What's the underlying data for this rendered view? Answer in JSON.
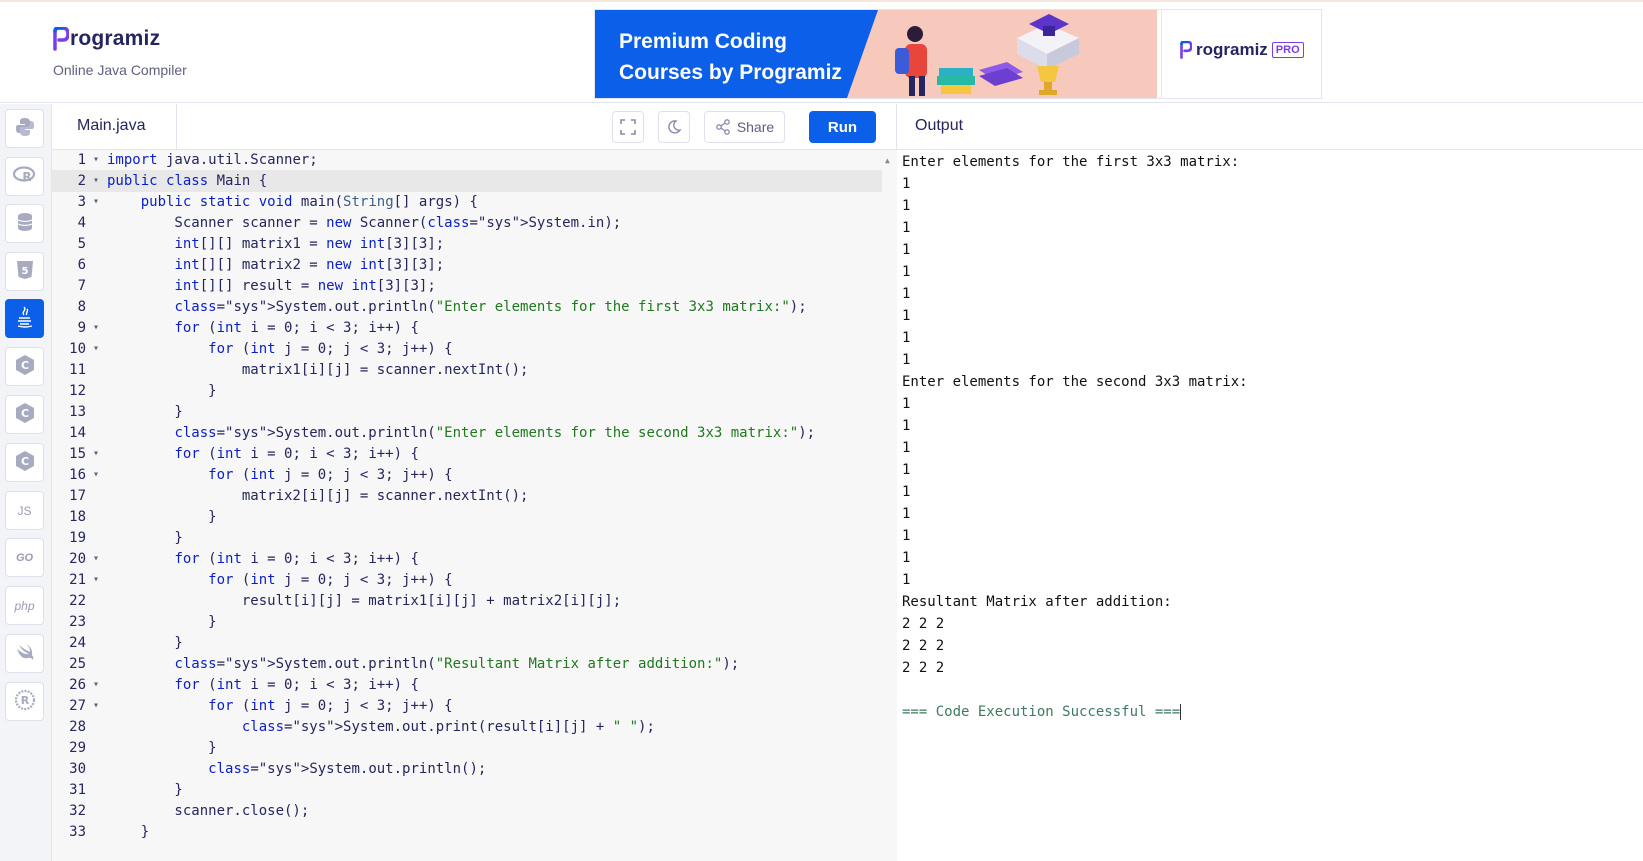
{
  "app": {
    "logo_text": "rogramiz",
    "subtitle": "Online Java Compiler"
  },
  "banner": {
    "title_line1": "Premium Coding",
    "title_line2": "Courses by Programiz",
    "pro_logo_text": "rogramiz",
    "pro_badge": "PRO"
  },
  "sidebar": {
    "items": [
      {
        "icon": "python-icon",
        "glyph": "",
        "active": false
      },
      {
        "icon": "r-lang-icon",
        "glyph": "R",
        "active": false
      },
      {
        "icon": "sql-database-icon",
        "glyph": "",
        "active": false
      },
      {
        "icon": "html5-icon",
        "glyph": "5",
        "active": false
      },
      {
        "icon": "java-icon",
        "glyph": "☕",
        "active": true
      },
      {
        "icon": "c-lang-icon",
        "glyph": "C",
        "active": false
      },
      {
        "icon": "cpp-icon",
        "glyph": "C",
        "active": false
      },
      {
        "icon": "csharp-icon",
        "glyph": "C",
        "active": false
      },
      {
        "icon": "javascript-icon",
        "glyph": "JS",
        "active": false
      },
      {
        "icon": "go-icon",
        "glyph": "GO",
        "active": false
      },
      {
        "icon": "php-icon",
        "glyph": "php",
        "active": false
      },
      {
        "icon": "swift-icon",
        "glyph": "➹",
        "active": false
      },
      {
        "icon": "rust-icon",
        "glyph": "R",
        "active": false
      }
    ]
  },
  "editor": {
    "file_name": "Main.java",
    "share_label": "Share",
    "run_label": "Run",
    "highlighted_line": 2,
    "lines": [
      {
        "n": "1",
        "fold": true,
        "text": "import java.util.Scanner;"
      },
      {
        "n": "2",
        "fold": true,
        "text": "public class Main {"
      },
      {
        "n": "3",
        "fold": true,
        "text": "    public static void main(String[] args) {"
      },
      {
        "n": "4",
        "fold": false,
        "text": "        Scanner scanner = new Scanner(System.in);"
      },
      {
        "n": "5",
        "fold": false,
        "text": "        int[][] matrix1 = new int[3][3];"
      },
      {
        "n": "6",
        "fold": false,
        "text": "        int[][] matrix2 = new int[3][3];"
      },
      {
        "n": "7",
        "fold": false,
        "text": "        int[][] result = new int[3][3];"
      },
      {
        "n": "8",
        "fold": false,
        "text": "        System.out.println(\"Enter elements for the first 3x3 matrix:\");"
      },
      {
        "n": "9",
        "fold": true,
        "text": "        for (int i = 0; i < 3; i++) {"
      },
      {
        "n": "10",
        "fold": true,
        "text": "            for (int j = 0; j < 3; j++) {"
      },
      {
        "n": "11",
        "fold": false,
        "text": "                matrix1[i][j] = scanner.nextInt();"
      },
      {
        "n": "12",
        "fold": false,
        "text": "            }"
      },
      {
        "n": "13",
        "fold": false,
        "text": "        }"
      },
      {
        "n": "14",
        "fold": false,
        "text": "        System.out.println(\"Enter elements for the second 3x3 matrix:\");"
      },
      {
        "n": "15",
        "fold": true,
        "text": "        for (int i = 0; i < 3; i++) {"
      },
      {
        "n": "16",
        "fold": true,
        "text": "            for (int j = 0; j < 3; j++) {"
      },
      {
        "n": "17",
        "fold": false,
        "text": "                matrix2[i][j] = scanner.nextInt();"
      },
      {
        "n": "18",
        "fold": false,
        "text": "            }"
      },
      {
        "n": "19",
        "fold": false,
        "text": "        }"
      },
      {
        "n": "20",
        "fold": true,
        "text": "        for (int i = 0; i < 3; i++) {"
      },
      {
        "n": "21",
        "fold": true,
        "text": "            for (int j = 0; j < 3; j++) {"
      },
      {
        "n": "22",
        "fold": false,
        "text": "                result[i][j] = matrix1[i][j] + matrix2[i][j];"
      },
      {
        "n": "23",
        "fold": false,
        "text": "            }"
      },
      {
        "n": "24",
        "fold": false,
        "text": "        }"
      },
      {
        "n": "25",
        "fold": false,
        "text": "        System.out.println(\"Resultant Matrix after addition:\");"
      },
      {
        "n": "26",
        "fold": true,
        "text": "        for (int i = 0; i < 3; i++) {"
      },
      {
        "n": "27",
        "fold": true,
        "text": "            for (int j = 0; j < 3; j++) {"
      },
      {
        "n": "28",
        "fold": false,
        "text": "                System.out.print(result[i][j] + \" \");"
      },
      {
        "n": "29",
        "fold": false,
        "text": "            }"
      },
      {
        "n": "30",
        "fold": false,
        "text": "            System.out.println();"
      },
      {
        "n": "31",
        "fold": false,
        "text": "        }"
      },
      {
        "n": "32",
        "fold": false,
        "text": "        scanner.close();"
      },
      {
        "n": "33",
        "fold": false,
        "text": "    }"
      }
    ]
  },
  "output": {
    "title": "Output",
    "lines": [
      "Enter elements for the first 3x3 matrix:",
      "1",
      "1",
      "1",
      "1",
      "1",
      "1",
      "1",
      "1",
      "1",
      "Enter elements for the second 3x3 matrix:",
      "1",
      "1",
      "1",
      "1",
      "1",
      "1",
      "1",
      "1",
      "1",
      "Resultant Matrix after addition:",
      "2 2 2",
      "2 2 2",
      "2 2 2",
      ""
    ],
    "success": "=== Code Execution Successful ==="
  },
  "colors": {
    "brand_blue": "#0b5fe8",
    "keyword": "#0b1fc8",
    "string": "#20781f",
    "pro_purple": "#7a3ee8"
  }
}
